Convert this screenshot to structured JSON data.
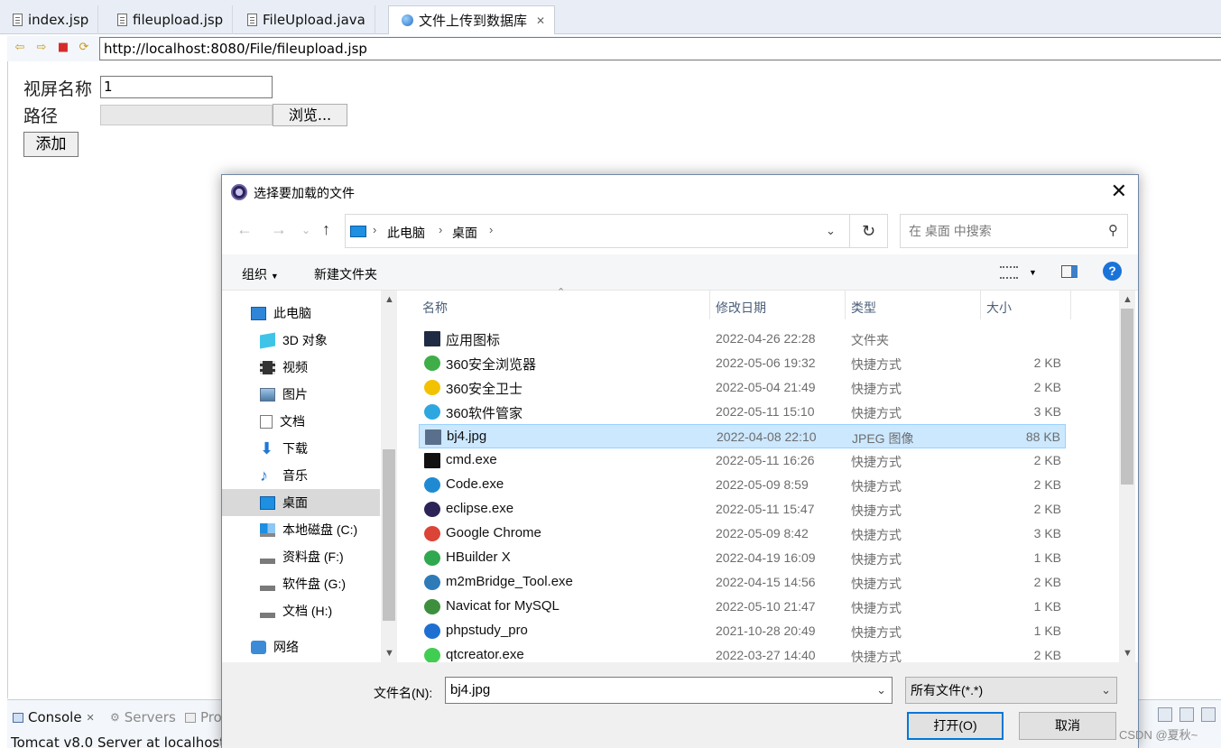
{
  "editor_tabs": [
    {
      "label": "index.jsp"
    },
    {
      "label": "fileupload.jsp"
    },
    {
      "label": "FileUpload.java"
    },
    {
      "label": "文件上传到数据库"
    }
  ],
  "browser": {
    "url": "http://localhost:8080/File/fileupload.jsp"
  },
  "form": {
    "name_label": "视屏名称",
    "name_value": "1",
    "path_label": "路径",
    "browse_label": "浏览...",
    "add_label": "添加"
  },
  "console": {
    "tabs": [
      "Console",
      "Servers",
      "Pro"
    ],
    "status_line": "Tomcat v8.0 Server at localhost ["
  },
  "dialog": {
    "title": "选择要加载的文件",
    "breadcrumb": [
      "此电脑",
      "桌面"
    ],
    "search_placeholder": "在 桌面 中搜索",
    "toolbar": {
      "organize": "组织",
      "new_folder": "新建文件夹"
    },
    "tree": [
      {
        "label": "此电脑",
        "icon": "computer-icon"
      },
      {
        "label": "3D 对象",
        "icon": "cube-icon"
      },
      {
        "label": "视频",
        "icon": "video-icon"
      },
      {
        "label": "图片",
        "icon": "picture-icon"
      },
      {
        "label": "文档",
        "icon": "document-icon"
      },
      {
        "label": "下载",
        "icon": "download-icon"
      },
      {
        "label": "音乐",
        "icon": "music-icon"
      },
      {
        "label": "桌面",
        "icon": "desktop-icon"
      },
      {
        "label": "本地磁盘 (C:)",
        "icon": "windows-drive-icon"
      },
      {
        "label": "资料盘 (F:)",
        "icon": "drive-icon"
      },
      {
        "label": "软件盘 (G:)",
        "icon": "drive-icon"
      },
      {
        "label": "文档 (H:)",
        "icon": "drive-icon"
      },
      {
        "label": "网络",
        "icon": "network-icon"
      }
    ],
    "columns": {
      "name": "名称",
      "date": "修改日期",
      "type": "类型",
      "size": "大小"
    },
    "files": [
      {
        "name": "应用图标",
        "date": "2022-04-26 22:28",
        "type": "文件夹",
        "size": "",
        "color": "#1f2a44"
      },
      {
        "name": "360安全浏览器",
        "date": "2022-05-06 19:32",
        "type": "快捷方式",
        "size": "2 KB",
        "color": "#3fae49"
      },
      {
        "name": "360安全卫士",
        "date": "2022-05-04 21:49",
        "type": "快捷方式",
        "size": "2 KB",
        "color": "#f2c200"
      },
      {
        "name": "360软件管家",
        "date": "2022-05-11 15:10",
        "type": "快捷方式",
        "size": "3 KB",
        "color": "#2ea7e0"
      },
      {
        "name": "bj4.jpg",
        "date": "2022-04-08 22:10",
        "type": "JPEG 图像",
        "size": "88 KB",
        "color": "#5a6f8c"
      },
      {
        "name": "cmd.exe",
        "date": "2022-05-11 16:26",
        "type": "快捷方式",
        "size": "2 KB",
        "color": "#111111"
      },
      {
        "name": "Code.exe",
        "date": "2022-05-09 8:59",
        "type": "快捷方式",
        "size": "2 KB",
        "color": "#1f8ad2"
      },
      {
        "name": "eclipse.exe",
        "date": "2022-05-11 15:47",
        "type": "快捷方式",
        "size": "2 KB",
        "color": "#2c2356"
      },
      {
        "name": "Google Chrome",
        "date": "2022-05-09 8:42",
        "type": "快捷方式",
        "size": "3 KB",
        "color": "#db4437"
      },
      {
        "name": "HBuilder X",
        "date": "2022-04-19 16:09",
        "type": "快捷方式",
        "size": "1 KB",
        "color": "#2fa84f"
      },
      {
        "name": "m2mBridge_Tool.exe",
        "date": "2022-04-15 14:56",
        "type": "快捷方式",
        "size": "2 KB",
        "color": "#2e7bb8"
      },
      {
        "name": "Navicat for MySQL",
        "date": "2022-05-10 21:47",
        "type": "快捷方式",
        "size": "1 KB",
        "color": "#3d8f3d"
      },
      {
        "name": "phpstudy_pro",
        "date": "2021-10-28 20:49",
        "type": "快捷方式",
        "size": "1 KB",
        "color": "#1e6fd1"
      },
      {
        "name": "qtcreator.exe",
        "date": "2022-03-27 14:40",
        "type": "快捷方式",
        "size": "2 KB",
        "color": "#41cd52"
      }
    ],
    "filename_label": "文件名(N):",
    "filename_value": "bj4.jpg",
    "filetype_value": "所有文件(*.*)",
    "open_label": "打开(O)",
    "cancel_label": "取消"
  },
  "watermark": "CSDN @夏秋~"
}
